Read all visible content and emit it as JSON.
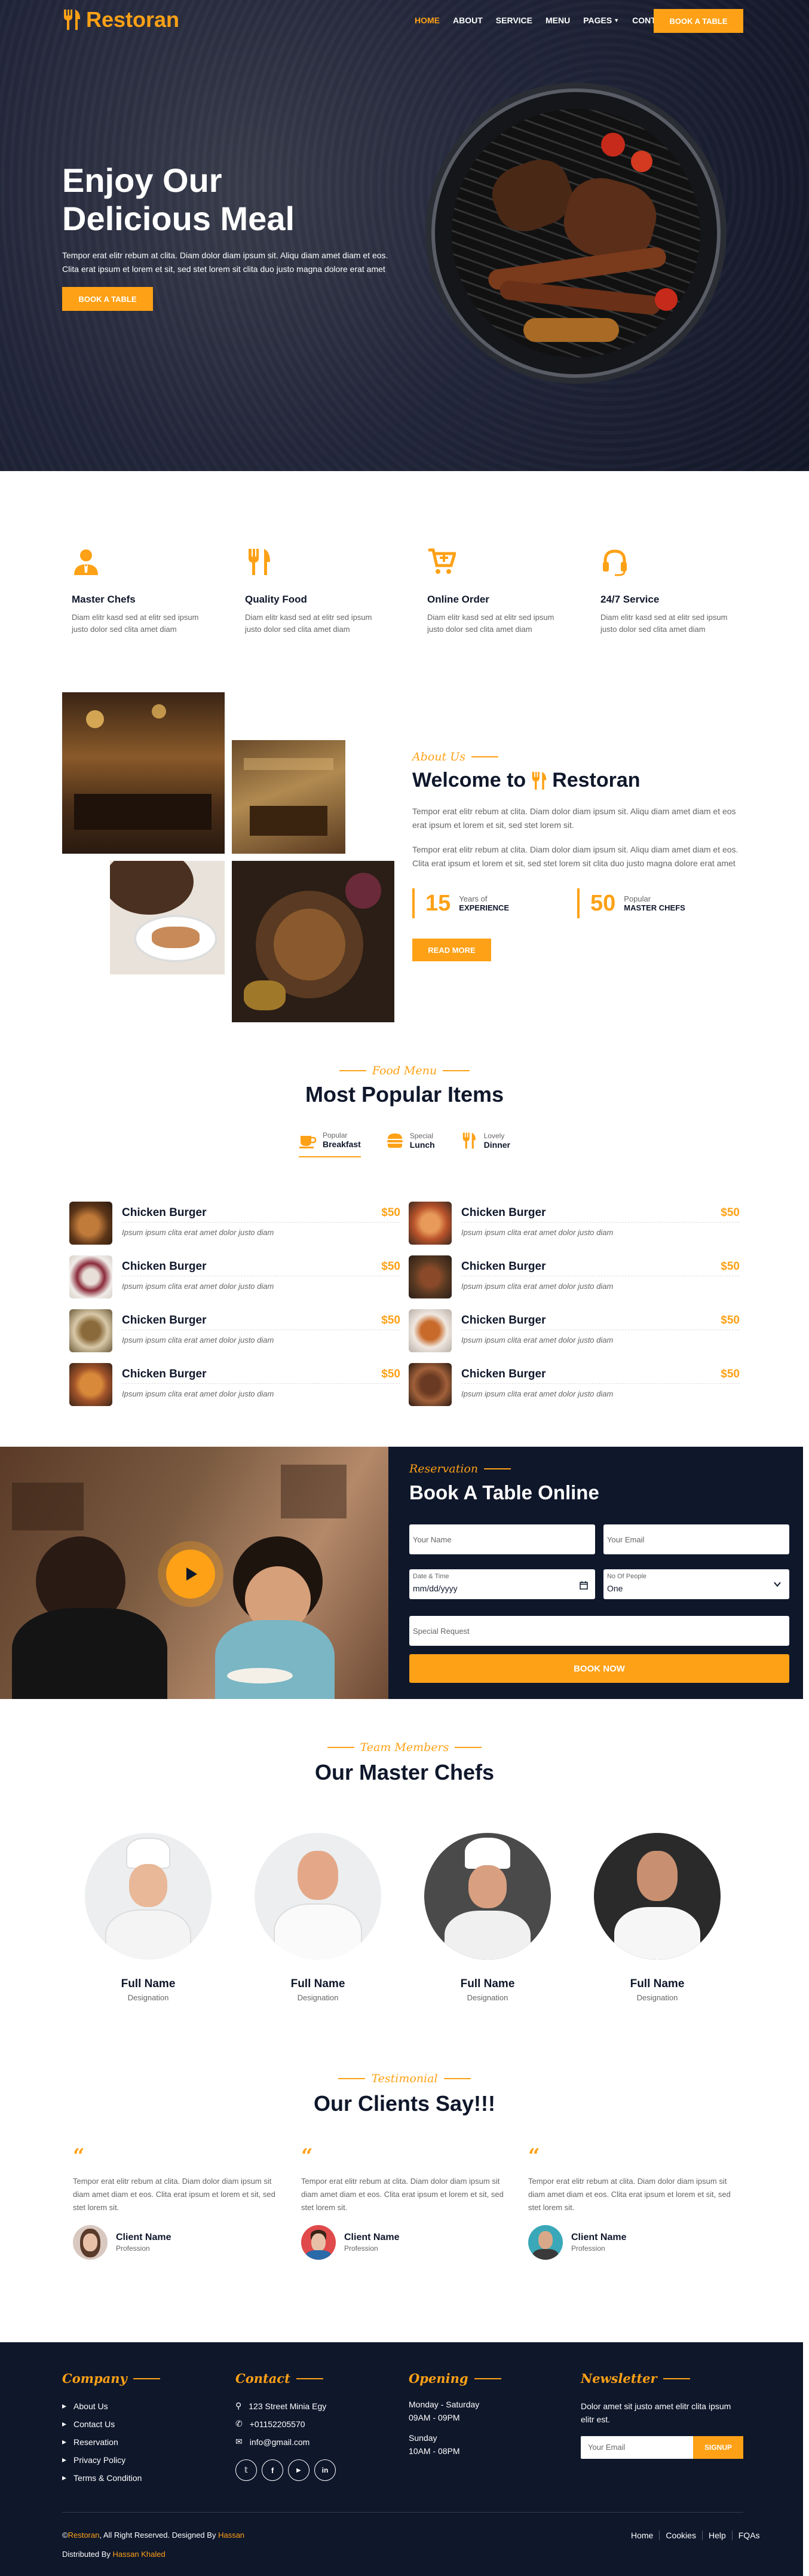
{
  "brand": {
    "name": "Restoran",
    "accent": "#fea116",
    "dark": "#0f172b"
  },
  "nav": {
    "links": [
      "Home",
      "About",
      "Service",
      "Menu",
      "Pages",
      "Contact"
    ],
    "active": "Home",
    "book_label": "Book A Table"
  },
  "hero": {
    "title_line1": "Enjoy Our",
    "title_line2": "Delicious Meal",
    "text": "Tempor erat elitr rebum at clita. Diam dolor diam ipsum sit. Aliqu diam amet diam et eos. Clita erat ipsum et lorem et sit, sed stet lorem sit clita duo justo magna dolore erat amet",
    "button": "Book A Table"
  },
  "services": [
    {
      "icon": "user-tie-icon",
      "title": "Master Chefs",
      "text": "Diam elitr kasd sed at elitr sed ipsum justo dolor sed clita amet diam"
    },
    {
      "icon": "utensils-icon",
      "title": "Quality Food",
      "text": "Diam elitr kasd sed at elitr sed ipsum justo dolor sed clita amet diam"
    },
    {
      "icon": "cart-plus-icon",
      "title": "Online Order",
      "text": "Diam elitr kasd sed at elitr sed ipsum justo dolor sed clita amet diam"
    },
    {
      "icon": "headset-icon",
      "title": "24/7 Service",
      "text": "Diam elitr kasd sed at elitr sed ipsum justo dolor sed clita amet diam"
    }
  ],
  "about": {
    "subtitle": "About Us",
    "title_prefix": "Welcome to",
    "title_brand": "Restoran",
    "p1": "Tempor erat elitr rebum at clita. Diam dolor diam ipsum sit. Aliqu diam amet diam et eos erat ipsum et lorem et sit, sed stet lorem sit.",
    "p2": "Tempor erat elitr rebum at clita. Diam dolor diam ipsum sit. Aliqu diam amet diam et eos. Clita erat ipsum et lorem et sit, sed stet lorem sit clita duo justo magna dolore erat amet",
    "stats": [
      {
        "num": "15",
        "small": "Years of",
        "big": "Experience"
      },
      {
        "num": "50",
        "small": "Popular",
        "big": "Master Chefs"
      }
    ],
    "button": "Read More"
  },
  "menu": {
    "subtitle": "Food Menu",
    "title": "Most Popular Items",
    "tabs": [
      {
        "icon": "coffee-icon",
        "small": "Popular",
        "big": "Breakfast"
      },
      {
        "icon": "hamburger-icon",
        "small": "Special",
        "big": "Lunch"
      },
      {
        "icon": "utensils-icon",
        "small": "Lovely",
        "big": "Dinner"
      }
    ],
    "items": [
      {
        "name": "Chicken Burger",
        "price": "$50",
        "desc": "Ipsum ipsum clita erat amet dolor justo diam"
      },
      {
        "name": "Chicken Burger",
        "price": "$50",
        "desc": "Ipsum ipsum clita erat amet dolor justo diam"
      },
      {
        "name": "Chicken Burger",
        "price": "$50",
        "desc": "Ipsum ipsum clita erat amet dolor justo diam"
      },
      {
        "name": "Chicken Burger",
        "price": "$50",
        "desc": "Ipsum ipsum clita erat amet dolor justo diam"
      },
      {
        "name": "Chicken Burger",
        "price": "$50",
        "desc": "Ipsum ipsum clita erat amet dolor justo diam"
      },
      {
        "name": "Chicken Burger",
        "price": "$50",
        "desc": "Ipsum ipsum clita erat amet dolor justo diam"
      },
      {
        "name": "Chicken Burger",
        "price": "$50",
        "desc": "Ipsum ipsum clita erat amet dolor justo diam"
      },
      {
        "name": "Chicken Burger",
        "price": "$50",
        "desc": "Ipsum ipsum clita erat amet dolor justo diam"
      }
    ]
  },
  "reservation": {
    "subtitle": "Reservation",
    "title": "Book A Table Online",
    "name_placeholder": "Your Name",
    "email_placeholder": "Your Email",
    "date_label": "Date & Time",
    "date_value": "mm/dd/yyyy",
    "people_label": "No Of People",
    "people_value": "One",
    "request_placeholder": "Special Request",
    "submit": "Book Now"
  },
  "team": {
    "subtitle": "Team Members",
    "title": "Our Master Chefs",
    "members": [
      {
        "name": "Full Name",
        "role": "Designation"
      },
      {
        "name": "Full Name",
        "role": "Designation"
      },
      {
        "name": "Full Name",
        "role": "Designation"
      },
      {
        "name": "Full Name",
        "role": "Designation"
      }
    ]
  },
  "testimonial": {
    "subtitle": "Testimonial",
    "title": "Our Clients Say!!!",
    "items": [
      {
        "text": "Tempor erat elitr rebum at clita. Diam dolor diam ipsum sit diam amet diam et eos. Clita erat ipsum et lorem et sit, sed stet lorem sit.",
        "name": "Client Name",
        "role": "Profession"
      },
      {
        "text": "Tempor erat elitr rebum at clita. Diam dolor diam ipsum sit diam amet diam et eos. Clita erat ipsum et lorem et sit, sed stet lorem sit.",
        "name": "Client Name",
        "role": "Profession"
      },
      {
        "text": "Tempor erat elitr rebum at clita. Diam dolor diam ipsum sit diam amet diam et eos. Clita erat ipsum et lorem et sit, sed stet lorem sit.",
        "name": "Client Name",
        "role": "Profession"
      }
    ]
  },
  "footer": {
    "company": {
      "heading": "Company",
      "links": [
        "About Us",
        "Contact Us",
        "Reservation",
        "Privacy Policy",
        "Terms & Condition"
      ]
    },
    "contact": {
      "heading": "Contact",
      "address": "123 Street Minia Egy",
      "phone": "+01152205570",
      "email": "info@gmail.com"
    },
    "opening": {
      "heading": "Opening",
      "days1": "Monday - Saturday",
      "hours1": "09AM - 09PM",
      "days2": "Sunday",
      "hours2": "10AM - 08PM"
    },
    "newsletter": {
      "heading": "Newsletter",
      "text": "Dolor amet sit justo amet elitr clita ipsum elitr est.",
      "placeholder": "Your Email",
      "button": "SignUp"
    },
    "copyright_prefix": "©",
    "copyright_brand": "Restoran",
    "copyright_mid": ", All Right Reserved. Designed By",
    "designer": "Hassan",
    "distributed_prefix": "Distributed By",
    "distributor": "Hassan Khaled",
    "menu": [
      "Home",
      "Cookies",
      "Help",
      "FQAs"
    ]
  }
}
